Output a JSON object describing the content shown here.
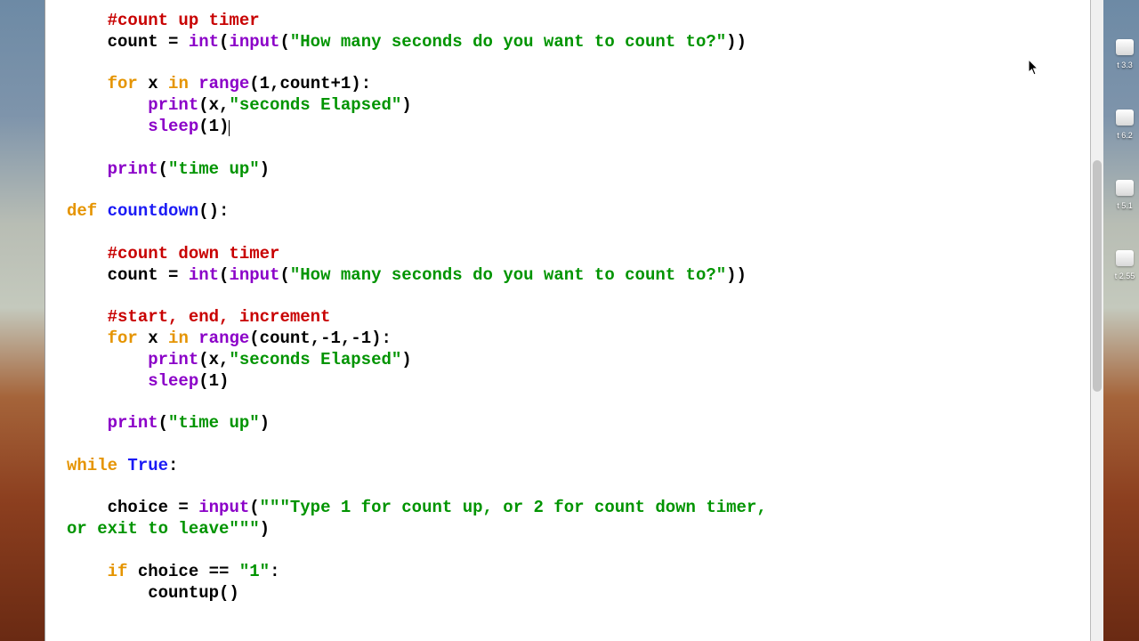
{
  "code": {
    "tokens": [
      [
        [
          "sp",
          "    "
        ],
        [
          "cmt",
          "#count up timer"
        ]
      ],
      [
        [
          "sp",
          "    "
        ],
        [
          "txt",
          "count = "
        ],
        [
          "fn",
          "int"
        ],
        [
          "txt",
          "("
        ],
        [
          "fn",
          "input"
        ],
        [
          "txt",
          "("
        ],
        [
          "str",
          "\"How many seconds do you want to count to?\""
        ],
        [
          "txt",
          "))"
        ]
      ],
      [],
      [
        [
          "sp",
          "    "
        ],
        [
          "kw",
          "for"
        ],
        [
          "txt",
          " x "
        ],
        [
          "kw",
          "in"
        ],
        [
          "txt",
          " "
        ],
        [
          "fn",
          "range"
        ],
        [
          "txt",
          "(1,count+1):"
        ]
      ],
      [
        [
          "sp",
          "        "
        ],
        [
          "fn",
          "print"
        ],
        [
          "txt",
          "(x,"
        ],
        [
          "str",
          "\"seconds Elapsed\""
        ],
        [
          "txt",
          ")"
        ]
      ],
      [
        [
          "sp",
          "        "
        ],
        [
          "fn",
          "sleep"
        ],
        [
          "txt",
          "(1)"
        ],
        [
          "caret",
          ""
        ]
      ],
      [],
      [
        [
          "sp",
          "    "
        ],
        [
          "fn",
          "print"
        ],
        [
          "txt",
          "("
        ],
        [
          "str",
          "\"time up\""
        ],
        [
          "txt",
          ")"
        ]
      ],
      [],
      [
        [
          "kw",
          "def"
        ],
        [
          "txt",
          " "
        ],
        [
          "nm",
          "countdown"
        ],
        [
          "txt",
          "():"
        ]
      ],
      [],
      [
        [
          "sp",
          "    "
        ],
        [
          "cmt",
          "#count down timer"
        ]
      ],
      [
        [
          "sp",
          "    "
        ],
        [
          "txt",
          "count = "
        ],
        [
          "fn",
          "int"
        ],
        [
          "txt",
          "("
        ],
        [
          "fn",
          "input"
        ],
        [
          "txt",
          "("
        ],
        [
          "str",
          "\"How many seconds do you want to count to?\""
        ],
        [
          "txt",
          "))"
        ]
      ],
      [],
      [
        [
          "sp",
          "    "
        ],
        [
          "cmt",
          "#start, end, increment"
        ]
      ],
      [
        [
          "sp",
          "    "
        ],
        [
          "kw",
          "for"
        ],
        [
          "txt",
          " x "
        ],
        [
          "kw",
          "in"
        ],
        [
          "txt",
          " "
        ],
        [
          "fn",
          "range"
        ],
        [
          "txt",
          "(count,-1,-1):"
        ]
      ],
      [
        [
          "sp",
          "        "
        ],
        [
          "fn",
          "print"
        ],
        [
          "txt",
          "(x,"
        ],
        [
          "str",
          "\"seconds Elapsed\""
        ],
        [
          "txt",
          ")"
        ]
      ],
      [
        [
          "sp",
          "        "
        ],
        [
          "fn",
          "sleep"
        ],
        [
          "txt",
          "(1)"
        ]
      ],
      [],
      [
        [
          "sp",
          "    "
        ],
        [
          "fn",
          "print"
        ],
        [
          "txt",
          "("
        ],
        [
          "str",
          "\"time up\""
        ],
        [
          "txt",
          ")"
        ]
      ],
      [],
      [
        [
          "kw",
          "while"
        ],
        [
          "txt",
          " "
        ],
        [
          "nm",
          "True"
        ],
        [
          "txt",
          ":"
        ]
      ],
      [],
      [
        [
          "sp",
          "    "
        ],
        [
          "txt",
          "choice = "
        ],
        [
          "fn",
          "input"
        ],
        [
          "txt",
          "("
        ],
        [
          "str",
          "\"\"\"Type 1 for count up, or 2 for count down timer,"
        ]
      ],
      [
        [
          "str",
          "or exit to leave\"\"\""
        ],
        [
          "txt",
          ")"
        ]
      ],
      [],
      [
        [
          "sp",
          "    "
        ],
        [
          "kw",
          "if"
        ],
        [
          "txt",
          " choice == "
        ],
        [
          "str",
          "\"1\""
        ],
        [
          "txt",
          ":"
        ]
      ],
      [
        [
          "sp",
          "        "
        ],
        [
          "txt",
          "countup()"
        ]
      ],
      []
    ]
  },
  "desktop": {
    "icons": [
      {
        "suffix": "3.3"
      },
      {
        "suffix": "6.2"
      },
      {
        "suffix": "5.1"
      },
      {
        "suffix": "2.55"
      }
    ]
  }
}
